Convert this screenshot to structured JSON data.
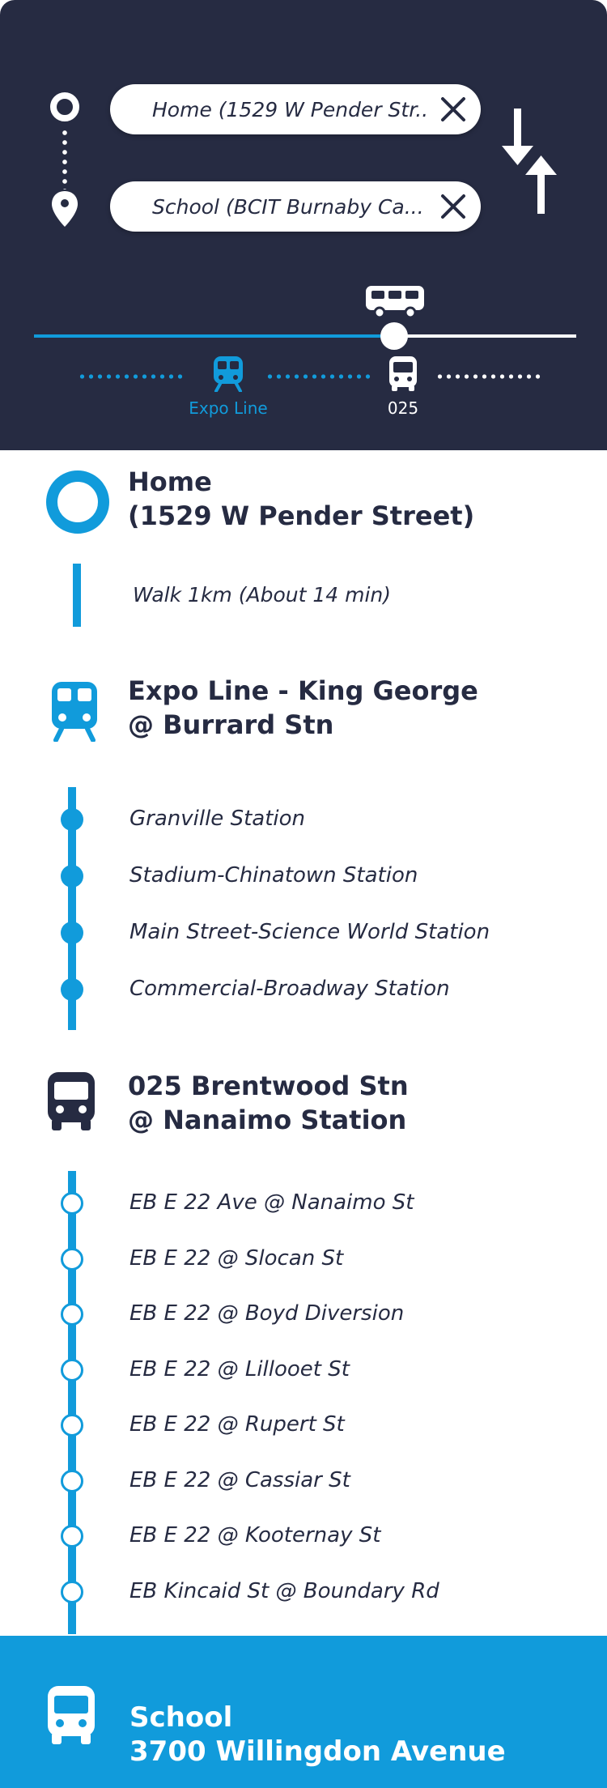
{
  "search": {
    "from_value": "Home (1529 W Pender Str...",
    "to_value": "School (BCIT Burnaby Ca..."
  },
  "modes": [
    {
      "label": "Expo Line",
      "icon": "train-icon",
      "color": "#119bdb"
    },
    {
      "label": "025",
      "icon": "bus-icon",
      "color": "#ffffff"
    }
  ],
  "timeline": {
    "progress": 0.67
  },
  "itinerary": {
    "origin": {
      "line1": "Home",
      "line2": "(1529 W Pender Street)"
    },
    "walk": "Walk 1km (About 14 min)",
    "train": {
      "line1": "Expo Line  - King George",
      "line2": "@ Burrard Stn",
      "stops": [
        "Granville Station",
        "Stadium-Chinatown Station",
        "Main Street-Science World Station",
        "Commercial-Broadway Station"
      ]
    },
    "bus": {
      "line1": "025 Brentwood Stn",
      "line2": "@ Nanaimo Station",
      "stops": [
        "EB E 22 Ave @ Nanaimo St",
        "EB E 22 @ Slocan St",
        "EB E 22 @ Boyd Diversion",
        "EB E 22 @ Lillooet St",
        "EB E 22 @ Rupert St",
        "EB E 22 @ Cassiar St",
        "EB E 22 @ Kooternay St",
        "EB Kincaid St @ Boundary Rd"
      ]
    },
    "destination": {
      "line1": "School",
      "line2": "3700 Willingdon Avenue"
    }
  },
  "colors": {
    "navy": "#262b42",
    "accent": "#119bdb",
    "white": "#ffffff"
  }
}
